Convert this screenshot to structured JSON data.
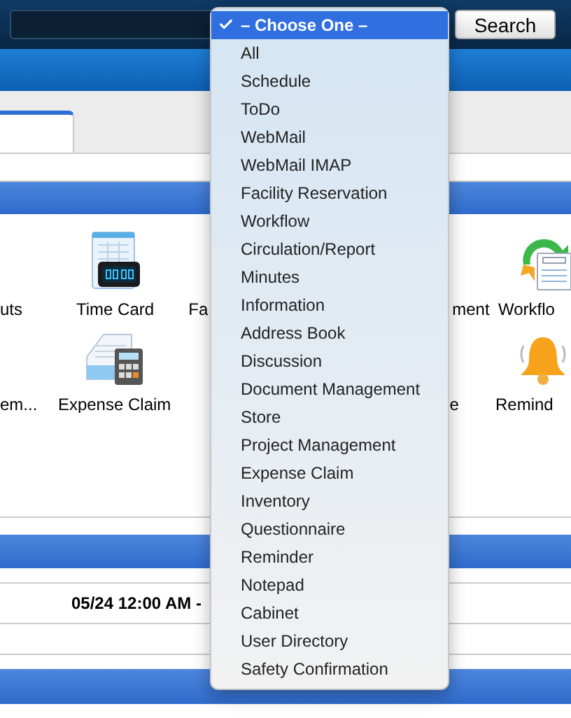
{
  "search": {
    "button": "Search"
  },
  "tab": {
    "selected": true
  },
  "apps": {
    "columns": [
      {
        "labels": [
          "uts",
          "em..."
        ]
      },
      {
        "labels": [
          "Time Card",
          "Expense Claim"
        ]
      },
      {
        "labels": [
          "Fa"
        ]
      },
      {
        "labels": [
          "ment",
          "e"
        ]
      },
      {
        "labels": [
          "Workflo",
          "Remind"
        ]
      }
    ]
  },
  "schedule": {
    "time": "05/24 12:00 AM -"
  },
  "dropdown": {
    "options": [
      {
        "label": "– Choose One –",
        "selected": true
      },
      {
        "label": "All",
        "selected": false
      },
      {
        "label": "Schedule",
        "selected": false
      },
      {
        "label": "ToDo",
        "selected": false
      },
      {
        "label": "WebMail",
        "selected": false
      },
      {
        "label": "WebMail IMAP",
        "selected": false
      },
      {
        "label": "Facility Reservation",
        "selected": false
      },
      {
        "label": "Workflow",
        "selected": false
      },
      {
        "label": "Circulation/Report",
        "selected": false
      },
      {
        "label": "Minutes",
        "selected": false
      },
      {
        "label": "Information",
        "selected": false
      },
      {
        "label": "Address Book",
        "selected": false
      },
      {
        "label": "Discussion",
        "selected": false
      },
      {
        "label": "Document Management",
        "selected": false
      },
      {
        "label": "Store",
        "selected": false
      },
      {
        "label": "Project Management",
        "selected": false
      },
      {
        "label": "Expense Claim",
        "selected": false
      },
      {
        "label": "Inventory",
        "selected": false
      },
      {
        "label": "Questionnaire",
        "selected": false
      },
      {
        "label": "Reminder",
        "selected": false
      },
      {
        "label": "Notepad",
        "selected": false
      },
      {
        "label": "Cabinet",
        "selected": false
      },
      {
        "label": "User Directory",
        "selected": false
      },
      {
        "label": "Safety Confirmation",
        "selected": false
      }
    ]
  }
}
